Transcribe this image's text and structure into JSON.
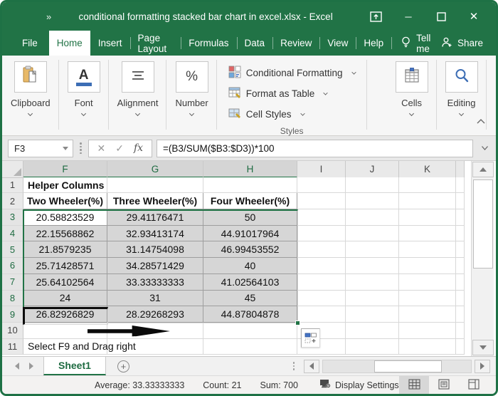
{
  "window": {
    "title": "conditional formatting stacked bar chart in excel.xlsx  -  Excel",
    "quick_access_glyph": "»",
    "minimize_glyph": "─",
    "close_glyph": "✕"
  },
  "ribbon_tabs": [
    "File",
    "Home",
    "Insert",
    "Page Layout",
    "Formulas",
    "Data",
    "Review",
    "View",
    "Help"
  ],
  "active_tab": "Home",
  "tell_me_label": "Tell me",
  "share_label": "Share",
  "ribbon": {
    "groups": {
      "clipboard": "Clipboard",
      "font": "Font",
      "alignment": "Alignment",
      "number": "Number",
      "cells": "Cells",
      "editing": "Editing"
    },
    "styles": {
      "caption": "Styles",
      "conditional_formatting": "Conditional Formatting",
      "format_as_table": "Format as Table",
      "cell_styles": "Cell Styles"
    },
    "font_button_glyph": "A",
    "number_button_glyph": "%"
  },
  "formula_bar": {
    "name_box": "F3",
    "cancel_glyph": "✕",
    "enter_glyph": "✓",
    "fx_glyph": "fx",
    "formula": "=(B3/SUM($B3:$D3))*100"
  },
  "grid": {
    "column_headers": [
      "F",
      "G",
      "H",
      "I",
      "J",
      "K"
    ],
    "selected_column_headers": [
      "F",
      "G",
      "H"
    ],
    "selected_row_headers": [
      "3",
      "4",
      "5",
      "6",
      "7",
      "8",
      "9"
    ],
    "selection_range": "F3:H9",
    "active_cell": "F3",
    "annotated_cell": "F9",
    "rows": [
      {
        "row": "1",
        "cells": [
          {
            "col": "F",
            "value": "Helper Columns",
            "bold": true,
            "align": "left"
          }
        ]
      },
      {
        "row": "2",
        "cells": [
          {
            "col": "F",
            "value": "Two Wheeler(%)",
            "bold": true
          },
          {
            "col": "G",
            "value": "Three Wheeler(%)",
            "bold": true
          },
          {
            "col": "H",
            "value": "Four Wheeler(%)",
            "bold": true
          }
        ]
      },
      {
        "row": "3",
        "cells": [
          {
            "col": "F",
            "value": "20.58823529"
          },
          {
            "col": "G",
            "value": "29.41176471"
          },
          {
            "col": "H",
            "value": "50"
          }
        ]
      },
      {
        "row": "4",
        "cells": [
          {
            "col": "F",
            "value": "22.15568862"
          },
          {
            "col": "G",
            "value": "32.93413174"
          },
          {
            "col": "H",
            "value": "44.91017964"
          }
        ]
      },
      {
        "row": "5",
        "cells": [
          {
            "col": "F",
            "value": "21.8579235"
          },
          {
            "col": "G",
            "value": "31.14754098"
          },
          {
            "col": "H",
            "value": "46.99453552"
          }
        ]
      },
      {
        "row": "6",
        "cells": [
          {
            "col": "F",
            "value": "25.71428571"
          },
          {
            "col": "G",
            "value": "34.28571429"
          },
          {
            "col": "H",
            "value": "40"
          }
        ]
      },
      {
        "row": "7",
        "cells": [
          {
            "col": "F",
            "value": "25.64102564"
          },
          {
            "col": "G",
            "value": "33.33333333"
          },
          {
            "col": "H",
            "value": "41.02564103"
          }
        ]
      },
      {
        "row": "8",
        "cells": [
          {
            "col": "F",
            "value": "24"
          },
          {
            "col": "G",
            "value": "31"
          },
          {
            "col": "H",
            "value": "45"
          }
        ]
      },
      {
        "row": "9",
        "cells": [
          {
            "col": "F",
            "value": "26.82926829"
          },
          {
            "col": "G",
            "value": "28.29268293"
          },
          {
            "col": "H",
            "value": "44.87804878"
          }
        ]
      },
      {
        "row": "10",
        "cells": []
      },
      {
        "row": "11",
        "cells": [
          {
            "col": "F",
            "value": "Select F9 and Drag right",
            "align": "left"
          }
        ]
      }
    ]
  },
  "sheet_bar": {
    "sheet_tab": "Sheet1",
    "add_sheet_glyph": "+"
  },
  "status_bar": {
    "average": "Average: 33.33333333",
    "count": "Count: 21",
    "sum": "Sum: 700",
    "display_settings": "Display Settings"
  },
  "colors": {
    "excel_green": "#217346",
    "selection_fill": "#d6d6d6",
    "accent_blue": "#4472c4"
  }
}
